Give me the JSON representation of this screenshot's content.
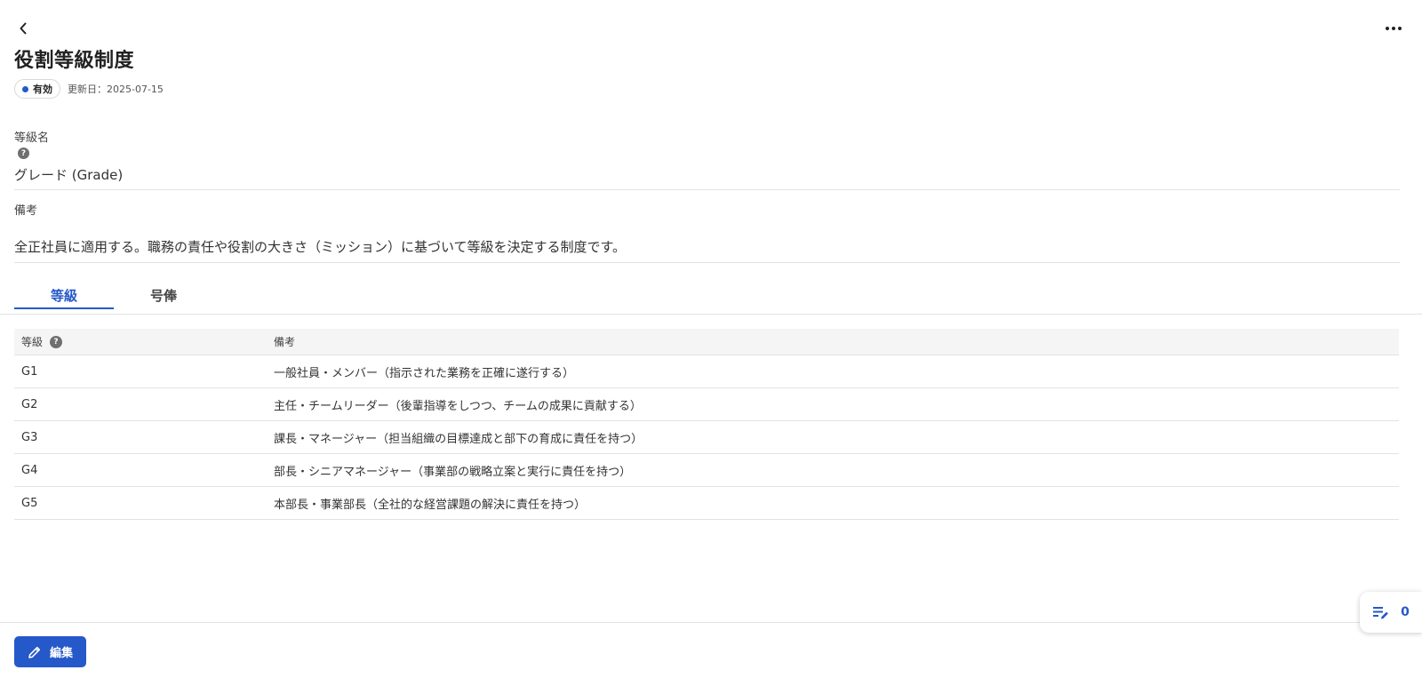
{
  "header": {
    "title": "役割等級制度",
    "status_label": "有効",
    "updated_text": "更新日：2025-07-15"
  },
  "fields": {
    "grade_name": {
      "label": "等級名",
      "help": "?",
      "value": "グレード (Grade)"
    },
    "remarks": {
      "label": "備考",
      "value": "全正社員に適用する。職務の責任や役割の大きさ（ミッション）に基づいて等級を決定する制度です。"
    }
  },
  "tabs": [
    {
      "label": "等級",
      "active": true
    },
    {
      "label": "号俸",
      "active": false
    }
  ],
  "table": {
    "headers": {
      "grade": "等級",
      "grade_help": "?",
      "remarks": "備考"
    },
    "rows": [
      {
        "grade": "G1",
        "remarks": "一般社員・メンバー（指示された業務を正確に遂行する）"
      },
      {
        "grade": "G2",
        "remarks": "主任・チームリーダー（後輩指導をしつつ、チームの成果に貢献する）"
      },
      {
        "grade": "G3",
        "remarks": "課長・マネージャー（担当組織の目標達成と部下の育成に責任を持つ）"
      },
      {
        "grade": "G4",
        "remarks": "部長・シニアマネージャー（事業部の戦略立案と実行に責任を持つ）"
      },
      {
        "grade": "G5",
        "remarks": "本部長・事業部長（全社的な経営課題の解決に責任を持つ）"
      }
    ]
  },
  "footer": {
    "edit_label": "編集"
  },
  "comment_widget": {
    "count": "0",
    "icon": "edit-note-icon"
  },
  "icons": {
    "back": "chevron-left-icon",
    "more": "more-horizontal-icon",
    "status": "status-dot-icon",
    "help": "help-circle-icon",
    "edit": "pencil-icon"
  },
  "colors": {
    "accent": "#2558c9",
    "status_dot": "#2558c9",
    "table_header_bg": "#f5f5f5",
    "divider": "#e3e3e3"
  }
}
